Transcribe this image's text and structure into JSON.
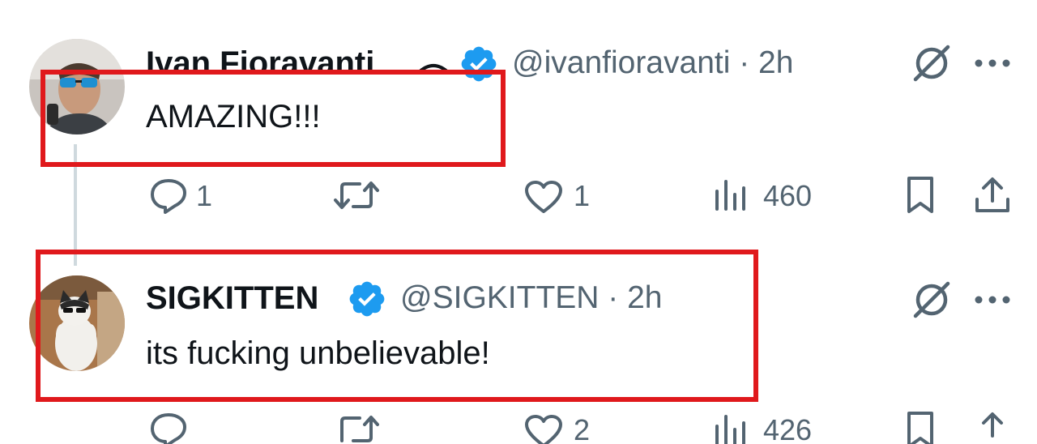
{
  "tweets": [
    {
      "author_name": "Ivan Fioravanti",
      "verified": true,
      "handle_time": "@ivanfioravanti · 2h",
      "text": "AMAZING!!!",
      "replies": "1",
      "retweets": "",
      "likes": "1",
      "views": "460"
    },
    {
      "author_name": "SIGKITTEN",
      "verified": true,
      "handle_time": "@SIGKITTEN · 2h",
      "text": "its fucking unbelievable!",
      "replies": "",
      "retweets": "",
      "likes": "2",
      "views": "426"
    }
  ],
  "icons": {
    "reply": "reply-icon",
    "retweet": "retweet-icon",
    "like": "heart-icon",
    "views": "views-icon",
    "bookmark": "bookmark-icon",
    "share": "share-icon",
    "grok": "grok-icon",
    "more": "more-icon",
    "verified": "verified-badge-icon"
  },
  "colors": {
    "verified_blue": "#1d9bf0",
    "highlight_red": "#e0191c",
    "secondary_text": "#536471"
  }
}
